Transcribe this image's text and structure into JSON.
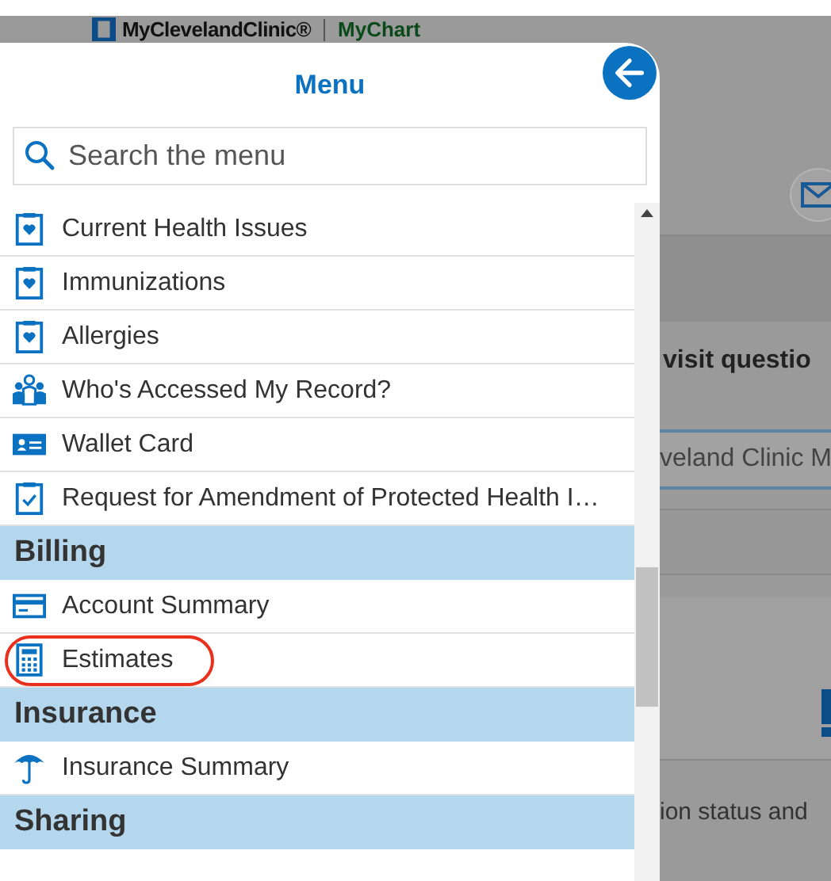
{
  "background_page": {
    "logo": "MyClevelandClinic®",
    "product": "MyChart",
    "heading": "visit questio",
    "field_value": "veland Clinic M",
    "note": "ion status and"
  },
  "menu": {
    "title": "Menu",
    "search": {
      "placeholder": "Search the menu"
    },
    "rows": [
      {
        "kind": "item",
        "label": "Current Health Issues",
        "highlighted": false
      },
      {
        "kind": "item",
        "label": "Immunizations",
        "highlighted": false
      },
      {
        "kind": "item",
        "label": "Allergies",
        "highlighted": false
      },
      {
        "kind": "item",
        "label": "Who's Accessed My Record?",
        "highlighted": false
      },
      {
        "kind": "item",
        "label": "Wallet Card",
        "highlighted": false
      },
      {
        "kind": "item",
        "label": "Request for Amendment of Protected Health I…",
        "highlighted": false
      },
      {
        "kind": "header",
        "label": "Billing"
      },
      {
        "kind": "item",
        "label": "Account Summary",
        "highlighted": false
      },
      {
        "kind": "item",
        "label": "Estimates",
        "highlighted": true
      },
      {
        "kind": "header",
        "label": "Insurance"
      },
      {
        "kind": "item",
        "label": "Insurance Summary",
        "highlighted": false
      },
      {
        "kind": "header",
        "label": "Sharing"
      }
    ]
  }
}
